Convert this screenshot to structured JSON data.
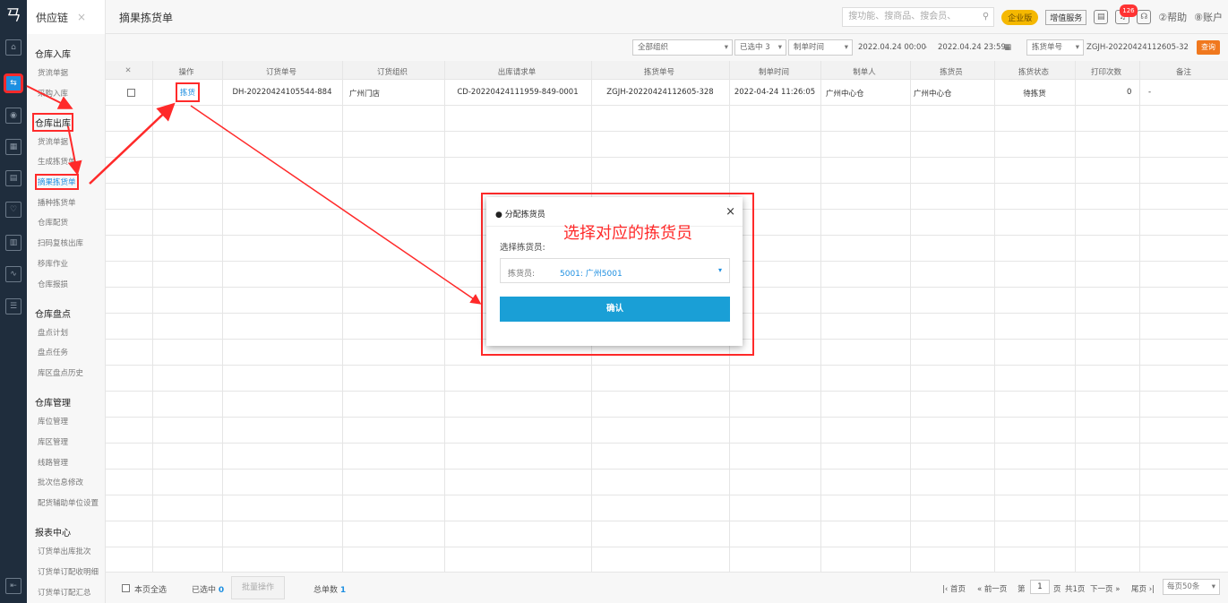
{
  "app": {
    "logo_glyph": "ㄢ",
    "module_title": "供应链",
    "module_close": "×",
    "tab_title": "摘果拣货单"
  },
  "topbar": {
    "search_placeholder": "搜功能、搜商品、搜会员、",
    "edition_badge": "企业版",
    "value_added": "增值服务",
    "notif_count": "126",
    "help": "②帮助",
    "account": "⑧账户"
  },
  "rail_icons": [
    {
      "name": "home-icon",
      "glyph": "⌂"
    },
    {
      "name": "supply-chain-icon",
      "glyph": "⇆"
    },
    {
      "name": "camera-icon",
      "glyph": "◉"
    },
    {
      "name": "calendar-icon",
      "glyph": "▦"
    },
    {
      "name": "document-icon",
      "glyph": "▤"
    },
    {
      "name": "heart-icon",
      "glyph": "♡"
    },
    {
      "name": "building-icon",
      "glyph": "▥"
    },
    {
      "name": "chart-icon",
      "glyph": "∿"
    },
    {
      "name": "list-icon",
      "glyph": "☰"
    },
    {
      "name": "collapse-icon",
      "glyph": "⇤"
    }
  ],
  "sidebar": {
    "sections": [
      {
        "title": "仓库入库",
        "items": [
          "货流单据",
          "采购入库"
        ]
      },
      {
        "title": "仓库出库",
        "items": [
          "货流单据",
          "生成拣货单",
          "摘果拣货单",
          "播种拣货单",
          "仓库配货",
          "扫码复核出库",
          "移库作业",
          "仓库报损"
        ]
      },
      {
        "title": "仓库盘点",
        "items": [
          "盘点计划",
          "盘点任务",
          "库区盘点历史"
        ]
      },
      {
        "title": "仓库管理",
        "items": [
          "库位管理",
          "库区管理",
          "线路管理",
          "批次信息修改",
          "配货辅助单位设置"
        ]
      },
      {
        "title": "报表中心",
        "items": [
          "订货单出库批次",
          "订货单订配收明细",
          "订货单订配汇总"
        ]
      }
    ]
  },
  "filters": {
    "org": "全部组织",
    "selected": "已选中 3",
    "date_field": "制单时间",
    "start": "2022.04.24 00:00",
    "dash": "-",
    "end": "2022.04.24 23:59",
    "number_field": "拣货单号",
    "number_value": "ZGJH-20220424112605-32",
    "query": "查询",
    "caret": "▾",
    "cal": "▦"
  },
  "table": {
    "settings_glyph": "✕",
    "headers": [
      "操作",
      "订货单号",
      "订货组织",
      "出库请求单",
      "拣货单号",
      "制单时间",
      "制单人",
      "拣货员",
      "拣货状态",
      "打印次数",
      "备注"
    ],
    "row": {
      "action": "拣货",
      "order_no": "DH-20220424105544-884",
      "org": "广州门店",
      "request_no": "CD-20220424111959-849-0001",
      "pick_no": "ZGJH-20220424112605-328",
      "created": "2022-04-24 11:26:05",
      "creator": "广州中心仓",
      "picker": "广州中心仓",
      "status": "待拣货",
      "prints": "0",
      "remark": "-"
    }
  },
  "footer": {
    "select_all": "本页全选",
    "selected_label": "已选中",
    "selected_count": "0",
    "batch": "批量操作",
    "total_label": "总单数",
    "total_count": "1",
    "first": "|‹ 首页",
    "prev": "« 前一页",
    "page_prefix": "第",
    "page_no": "1",
    "page_suffix": "页",
    "total_pages": "共1页",
    "next": "下一页 »",
    "last": "尾页 ›|",
    "per_page": "每页50条"
  },
  "modal": {
    "title": "● 分配拣货员",
    "close": "×",
    "label": "选择拣货员:",
    "select_prefix": "拣货员:",
    "select_value": "5001: 广州5001",
    "caret": "▾",
    "confirm": "确认"
  },
  "annotation": "选择对应的拣货员",
  "colors": {
    "accent": "#1e8fe1",
    "annotation": "#ff2a2a",
    "rail": "#1f2d3d",
    "query": "#f0781e",
    "confirm": "#1a9fd6"
  }
}
